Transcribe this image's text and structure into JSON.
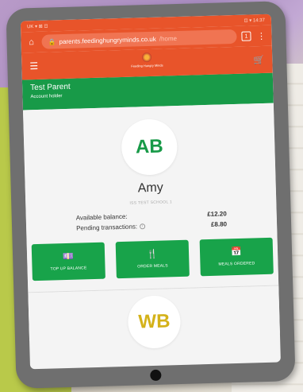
{
  "status_bar": {
    "left": "UK ▾ ⊠ ⊡",
    "right": "⊡ ▾ 14:37"
  },
  "browser": {
    "url_host": "parents.feedinghungryminds.co.uk",
    "url_path": "/home",
    "tab_count": "1"
  },
  "app_header": {
    "logo_text": "Feeding Hungry Minds"
  },
  "account": {
    "name": "Test Parent",
    "role": "Account holder"
  },
  "child": {
    "initials": "AB",
    "name": "Amy",
    "school": "ISS TEST SCHOOL 1",
    "balance_label": "Available balance:",
    "balance_value": "£12.20",
    "pending_label": "Pending transactions:",
    "pending_value": "£8.80"
  },
  "actions": [
    {
      "label": "TOP UP BALANCE",
      "icon": "money-icon"
    },
    {
      "label": "ORDER MEALS",
      "icon": "cutlery-icon"
    },
    {
      "label": "MEALS ORDERED",
      "icon": "calendar-icon"
    }
  ],
  "second_child": {
    "initials": "WB"
  },
  "colors": {
    "brand_orange": "#e8542a",
    "brand_green": "#189a48",
    "button_green": "#18a34a",
    "wb_yellow": "#d4b21a"
  }
}
